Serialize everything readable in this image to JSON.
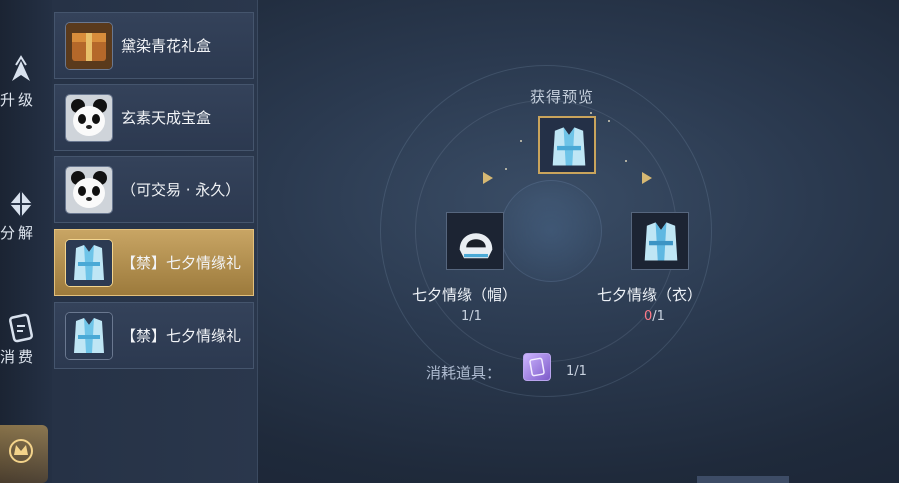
{
  "nav": {
    "items": [
      {
        "label": "升级",
        "icon": "upgrade-icon"
      },
      {
        "label": "分解",
        "icon": "decompose-icon"
      },
      {
        "label": "消费",
        "icon": "consume-icon"
      },
      {
        "label": "",
        "icon": "crown-emblem-icon"
      }
    ]
  },
  "list": {
    "items": [
      {
        "label": "黛染青花礼盒",
        "icon": "gift-chest-icon",
        "selected": false
      },
      {
        "label": "玄素天成宝盒",
        "icon": "panda-icon",
        "selected": false
      },
      {
        "label": "（可交易 · 永久）",
        "icon": "panda-icon",
        "selected": false
      },
      {
        "label": "【禁】七夕情缘礼",
        "icon": "outfit-icon",
        "selected": true
      },
      {
        "label": "【禁】七夕情缘礼",
        "icon": "outfit-icon",
        "selected": false
      }
    ]
  },
  "preview": {
    "title": "获得预览",
    "top_icon": "outfit-icon",
    "left": {
      "name": "七夕情缘（帽）",
      "count": "1/1",
      "icon": "hood-icon"
    },
    "right": {
      "name": "七夕情缘（衣）",
      "count_have": "0",
      "count_need": "/1",
      "icon": "robe-icon"
    }
  },
  "cost": {
    "label": "消耗道具：",
    "icon": "purple-scroll-icon",
    "count": "1/1"
  },
  "colors": {
    "gold_border": "#c9a45c",
    "selected_bg": "#c8a564",
    "insufficient_red": "#ff7a88"
  }
}
